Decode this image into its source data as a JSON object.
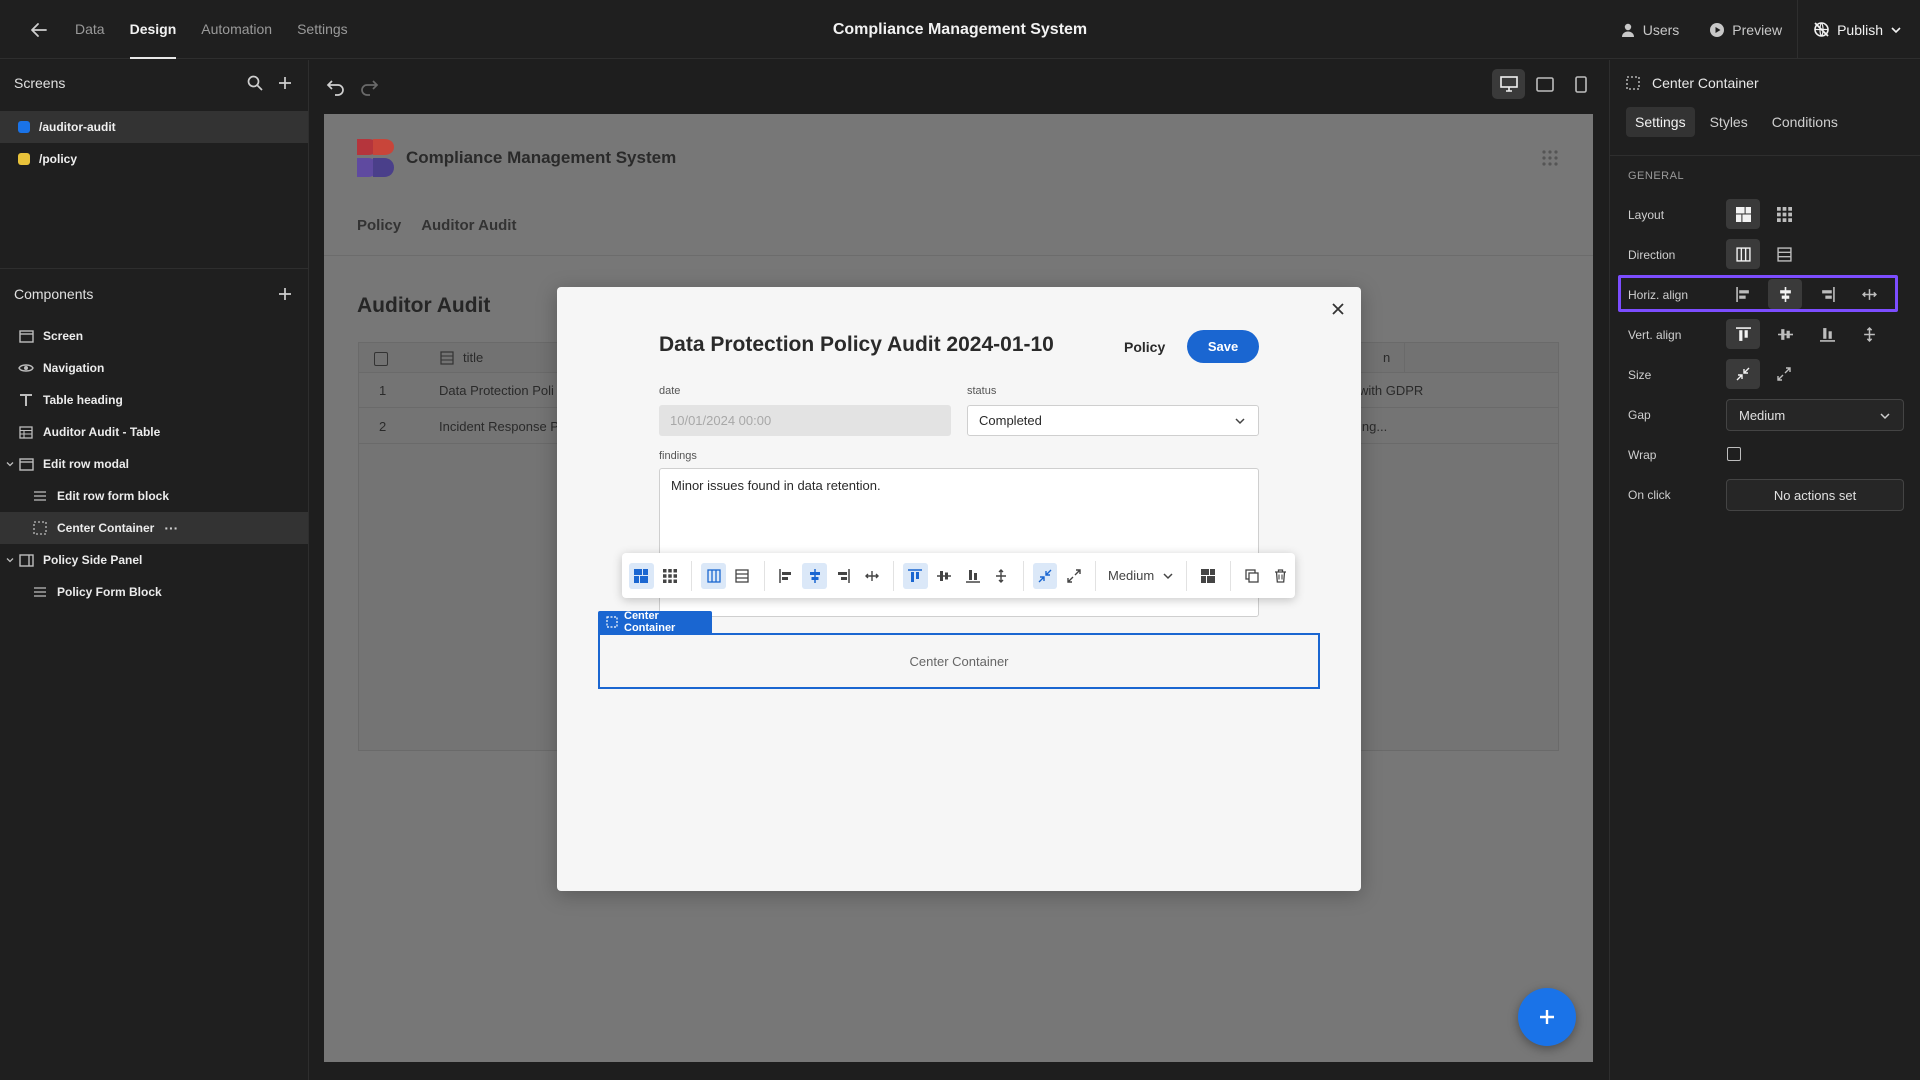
{
  "topbar": {
    "nav": [
      "Data",
      "Design",
      "Automation",
      "Settings"
    ],
    "active_nav": "Design",
    "title": "Compliance Management System",
    "users": "Users",
    "preview": "Preview",
    "publish": "Publish"
  },
  "left": {
    "screens_title": "Screens",
    "screens": [
      {
        "label": "/auditor-audit",
        "color": "#1a73e8"
      },
      {
        "label": "/policy",
        "color": "#e8c23a"
      }
    ],
    "components_title": "Components",
    "components": [
      {
        "label": "Screen",
        "icon": "screen-icon"
      },
      {
        "label": "Navigation",
        "icon": "eye-icon"
      },
      {
        "label": "Table heading",
        "icon": "text-icon"
      },
      {
        "label": "Auditor Audit - Table",
        "icon": "table-icon"
      },
      {
        "label": "Edit row modal",
        "icon": "modal-icon"
      },
      {
        "label": "Edit row form block",
        "icon": "form-icon"
      },
      {
        "label": "Center Container",
        "icon": "container-icon"
      },
      {
        "label": "Policy Side Panel",
        "icon": "side-panel-icon"
      },
      {
        "label": "Policy Form Block",
        "icon": "form-icon"
      }
    ],
    "more": "···"
  },
  "preview": {
    "site_title": "Compliance Management System",
    "nav": [
      "Policy",
      "Auditor Audit"
    ],
    "heading": "Auditor Audit",
    "table": {
      "col_title": "title",
      "col_right": "n",
      "rows": [
        {
          "num": "1",
          "title": "Data Protection Poli",
          "right": "with GDPR"
        },
        {
          "num": "2",
          "title": "Incident Response P",
          "right": "ing..."
        }
      ]
    }
  },
  "modal": {
    "title": "Data Protection Policy Audit 2024-01-10",
    "policy_link": "Policy",
    "save": "Save",
    "date_label": "date",
    "date_value": "10/01/2024 00:00",
    "status_label": "status",
    "status_value": "Completed",
    "findings_label": "findings",
    "findings_value": "Minor issues found in data retention."
  },
  "toolbar": {
    "gap_value": "Medium"
  },
  "center_container": {
    "tag": "Center Container",
    "placeholder": "Center Container"
  },
  "right": {
    "title": "Center Container",
    "tabs": [
      "Settings",
      "Styles",
      "Conditions"
    ],
    "section": "GENERAL",
    "props": {
      "layout": "Layout",
      "direction": "Direction",
      "horiz_align": "Horiz. align",
      "vert_align": "Vert. align",
      "size": "Size",
      "gap": "Gap",
      "wrap": "Wrap",
      "on_click": "On click"
    },
    "gap_value": "Medium",
    "on_click_value": "No actions set"
  },
  "colors": {
    "accent": "#1a66d1",
    "highlight": "#7c4dff"
  }
}
